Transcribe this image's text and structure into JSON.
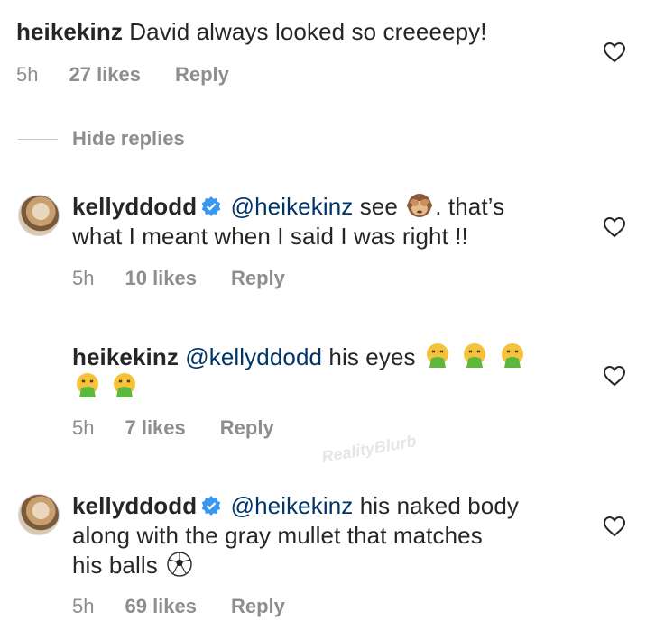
{
  "comment1": {
    "username": "heikekinz",
    "text": "David always looked so creeeepy!",
    "time": "5h",
    "likes": "27 likes",
    "reply": "Reply"
  },
  "hide_replies": "Hide replies",
  "reply1": {
    "username": "kellyddodd",
    "mention": "@heikekinz",
    "text_a": "see",
    "text_b": ". that’s",
    "text_line2": "what I meant when I said I was right !!",
    "time": "5h",
    "likes": "10 likes",
    "reply": "Reply",
    "emoji": "see-no-evil-monkey-icon"
  },
  "reply2": {
    "username": "heikekinz",
    "mention": "@kellyddodd",
    "text": "his eyes",
    "time": "5h",
    "likes": "7 likes",
    "reply": "Reply",
    "emoji": "vomiting-face-icon"
  },
  "reply3": {
    "username": "kellyddodd",
    "mention": "@heikekinz",
    "text_line1": "his naked body",
    "text_line2": "along with the gray mullet that matches",
    "text_line3": "his balls",
    "time": "5h",
    "likes": "69 likes",
    "reply": "Reply",
    "emoji": "soccer-ball-icon"
  },
  "watermark": "RealityBlurb",
  "colors": {
    "mention": "#003569",
    "meta": "#8e8e8e",
    "verified": "#3897f0",
    "text": "#262626"
  }
}
